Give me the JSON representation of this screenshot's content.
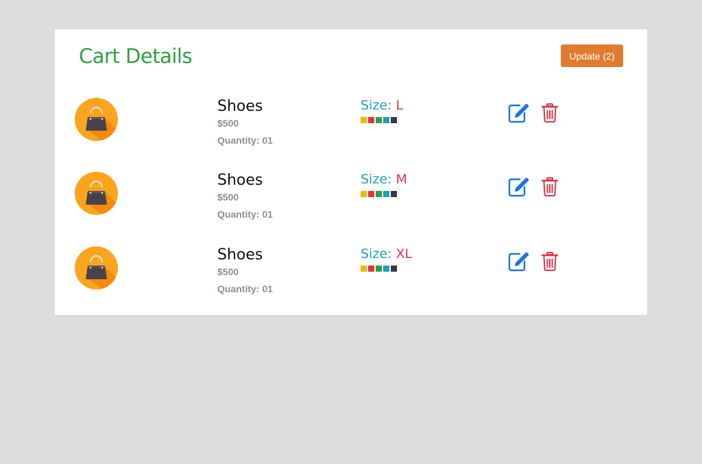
{
  "cart": {
    "title": "Cart Details",
    "update_label": "Update (2)"
  },
  "colors": {
    "title": "#2ea043",
    "update_button": "#e07b2f",
    "size_label": "#1fa0b8",
    "size_value": "#dc3545",
    "edit_icon": "#1a73e8",
    "delete_icon": "#dc3545",
    "avatar": "#fba51f",
    "swatches": [
      "#f5b400",
      "#dc3545",
      "#2ea043",
      "#1fa0b8",
      "#343a40"
    ]
  },
  "items": [
    {
      "icon": "shopping-bag-icon",
      "name": "Shoes",
      "price": "$500",
      "quantity": "Quantity: 01",
      "size_label": "Size:",
      "size_value": "L"
    },
    {
      "icon": "shopping-bag-icon",
      "name": "Shoes",
      "price": "$500",
      "quantity": "Quantity: 01",
      "size_label": "Size:",
      "size_value": "M"
    },
    {
      "icon": "shopping-bag-icon",
      "name": "Shoes",
      "price": "$500",
      "quantity": "Quantity: 01",
      "size_label": "Size:",
      "size_value": "XL"
    }
  ]
}
